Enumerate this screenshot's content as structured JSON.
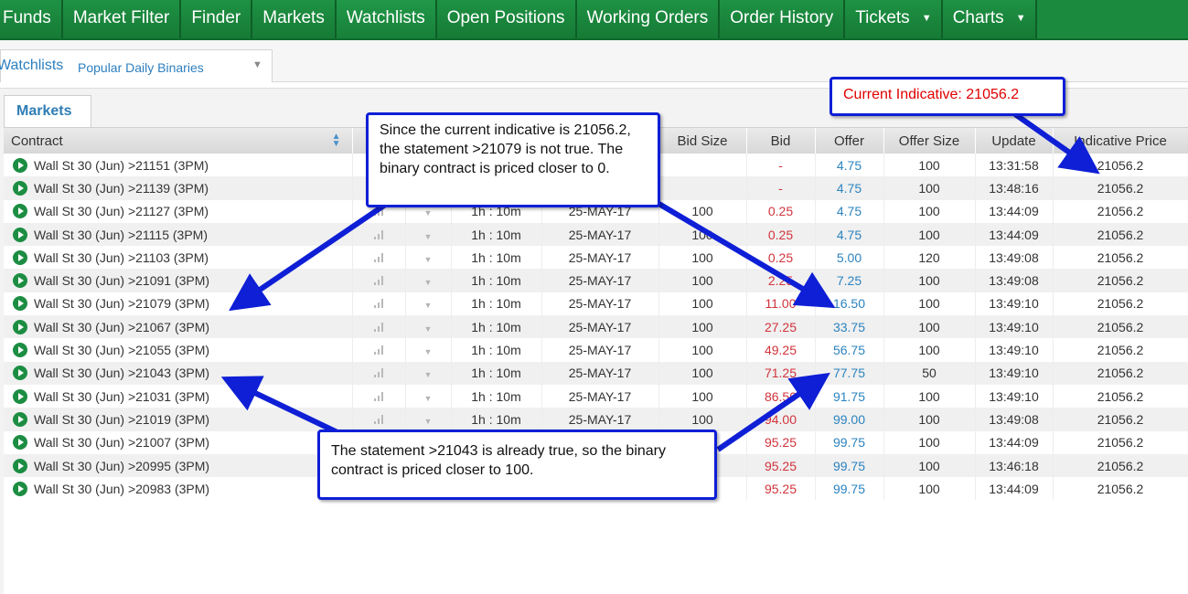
{
  "nav": {
    "items": [
      {
        "label": "Funds",
        "caret": false
      },
      {
        "label": "Market Filter",
        "caret": false
      },
      {
        "label": "Finder",
        "caret": false
      },
      {
        "label": "Markets",
        "caret": false
      },
      {
        "label": "Watchlists",
        "caret": false
      },
      {
        "label": "Open Positions",
        "caret": false
      },
      {
        "label": "Working Orders",
        "caret": false
      },
      {
        "label": "Order History",
        "caret": false
      },
      {
        "label": "Tickets",
        "caret": true
      },
      {
        "label": "Charts",
        "caret": true
      }
    ]
  },
  "watchlist": {
    "tab_label": "Watchlists",
    "selected": "Popular Daily Binaries"
  },
  "markets_tab": "Markets",
  "table": {
    "columns": [
      "Contract",
      "",
      "",
      "",
      "",
      "Bid Size",
      "Bid",
      "Offer",
      "Offer Size",
      "Update",
      "Indicative Price"
    ],
    "rows": [
      {
        "contract": "Wall St 30 (Jun) >21151 (3PM)",
        "time": "",
        "expiry": "",
        "bid_size": "",
        "bid": "-",
        "offer": "4.75",
        "offer_size": "100",
        "update": "13:31:58",
        "price": "21056.2"
      },
      {
        "contract": "Wall St 30 (Jun) >21139 (3PM)",
        "time": "",
        "expiry": "",
        "bid_size": "",
        "bid": "-",
        "offer": "4.75",
        "offer_size": "100",
        "update": "13:48:16",
        "price": "21056.2"
      },
      {
        "contract": "Wall St 30 (Jun) >21127 (3PM)",
        "time": "1h : 10m",
        "expiry": "25-MAY-17",
        "bid_size": "100",
        "bid": "0.25",
        "offer": "4.75",
        "offer_size": "100",
        "update": "13:44:09",
        "price": "21056.2"
      },
      {
        "contract": "Wall St 30 (Jun) >21115 (3PM)",
        "time": "1h : 10m",
        "expiry": "25-MAY-17",
        "bid_size": "100",
        "bid": "0.25",
        "offer": "4.75",
        "offer_size": "100",
        "update": "13:44:09",
        "price": "21056.2"
      },
      {
        "contract": "Wall St 30 (Jun) >21103 (3PM)",
        "time": "1h : 10m",
        "expiry": "25-MAY-17",
        "bid_size": "100",
        "bid": "0.25",
        "offer": "5.00",
        "offer_size": "120",
        "update": "13:49:08",
        "price": "21056.2"
      },
      {
        "contract": "Wall St 30 (Jun) >21091 (3PM)",
        "time": "1h : 10m",
        "expiry": "25-MAY-17",
        "bid_size": "100",
        "bid": "2.25",
        "offer": "7.25",
        "offer_size": "100",
        "update": "13:49:08",
        "price": "21056.2"
      },
      {
        "contract": "Wall St 30 (Jun) >21079 (3PM)",
        "time": "1h : 10m",
        "expiry": "25-MAY-17",
        "bid_size": "100",
        "bid": "11.00",
        "offer": "16.50",
        "offer_size": "100",
        "update": "13:49:10",
        "price": "21056.2"
      },
      {
        "contract": "Wall St 30 (Jun) >21067 (3PM)",
        "time": "1h : 10m",
        "expiry": "25-MAY-17",
        "bid_size": "100",
        "bid": "27.25",
        "offer": "33.75",
        "offer_size": "100",
        "update": "13:49:10",
        "price": "21056.2"
      },
      {
        "contract": "Wall St 30 (Jun) >21055 (3PM)",
        "time": "1h : 10m",
        "expiry": "25-MAY-17",
        "bid_size": "100",
        "bid": "49.25",
        "offer": "56.75",
        "offer_size": "100",
        "update": "13:49:10",
        "price": "21056.2"
      },
      {
        "contract": "Wall St 30 (Jun) >21043 (3PM)",
        "time": "1h : 10m",
        "expiry": "25-MAY-17",
        "bid_size": "100",
        "bid": "71.25",
        "offer": "77.75",
        "offer_size": "50",
        "update": "13:49:10",
        "price": "21056.2"
      },
      {
        "contract": "Wall St 30 (Jun) >21031 (3PM)",
        "time": "1h : 10m",
        "expiry": "25-MAY-17",
        "bid_size": "100",
        "bid": "86.50",
        "offer": "91.75",
        "offer_size": "100",
        "update": "13:49:10",
        "price": "21056.2"
      },
      {
        "contract": "Wall St 30 (Jun) >21019 (3PM)",
        "time": "1h : 10m",
        "expiry": "25-MAY-17",
        "bid_size": "100",
        "bid": "94.00",
        "offer": "99.00",
        "offer_size": "100",
        "update": "13:49:08",
        "price": "21056.2"
      },
      {
        "contract": "Wall St 30 (Jun) >21007 (3PM)",
        "time": "",
        "expiry": "",
        "bid_size": "",
        "bid": "95.25",
        "offer": "99.75",
        "offer_size": "100",
        "update": "13:44:09",
        "price": "21056.2"
      },
      {
        "contract": "Wall St 30 (Jun) >20995 (3PM)",
        "time": "",
        "expiry": "",
        "bid_size": "",
        "bid": "95.25",
        "offer": "99.75",
        "offer_size": "100",
        "update": "13:46:18",
        "price": "21056.2"
      },
      {
        "contract": "Wall St 30 (Jun) >20983 (3PM)",
        "time": "",
        "expiry": "",
        "bid_size": "",
        "bid": "95.25",
        "offer": "99.75",
        "offer_size": "100",
        "update": "13:44:09",
        "price": "21056.2"
      }
    ]
  },
  "callouts": {
    "indicative": "Current Indicative: 21056.2",
    "not_true": "Since the current indicative is 21056.2, the statement >21079 is not true. The binary contract is priced closer to 0.",
    "already_true": "The statement >21043 is already true, so the binary contract is priced closer to 100."
  },
  "colors": {
    "nav_green": "#1b8a3e",
    "callout_border": "#0e1fd6",
    "bid_red": "#d0343c",
    "offer_blue": "#2b83bf",
    "indicative_red": "#e00000"
  }
}
